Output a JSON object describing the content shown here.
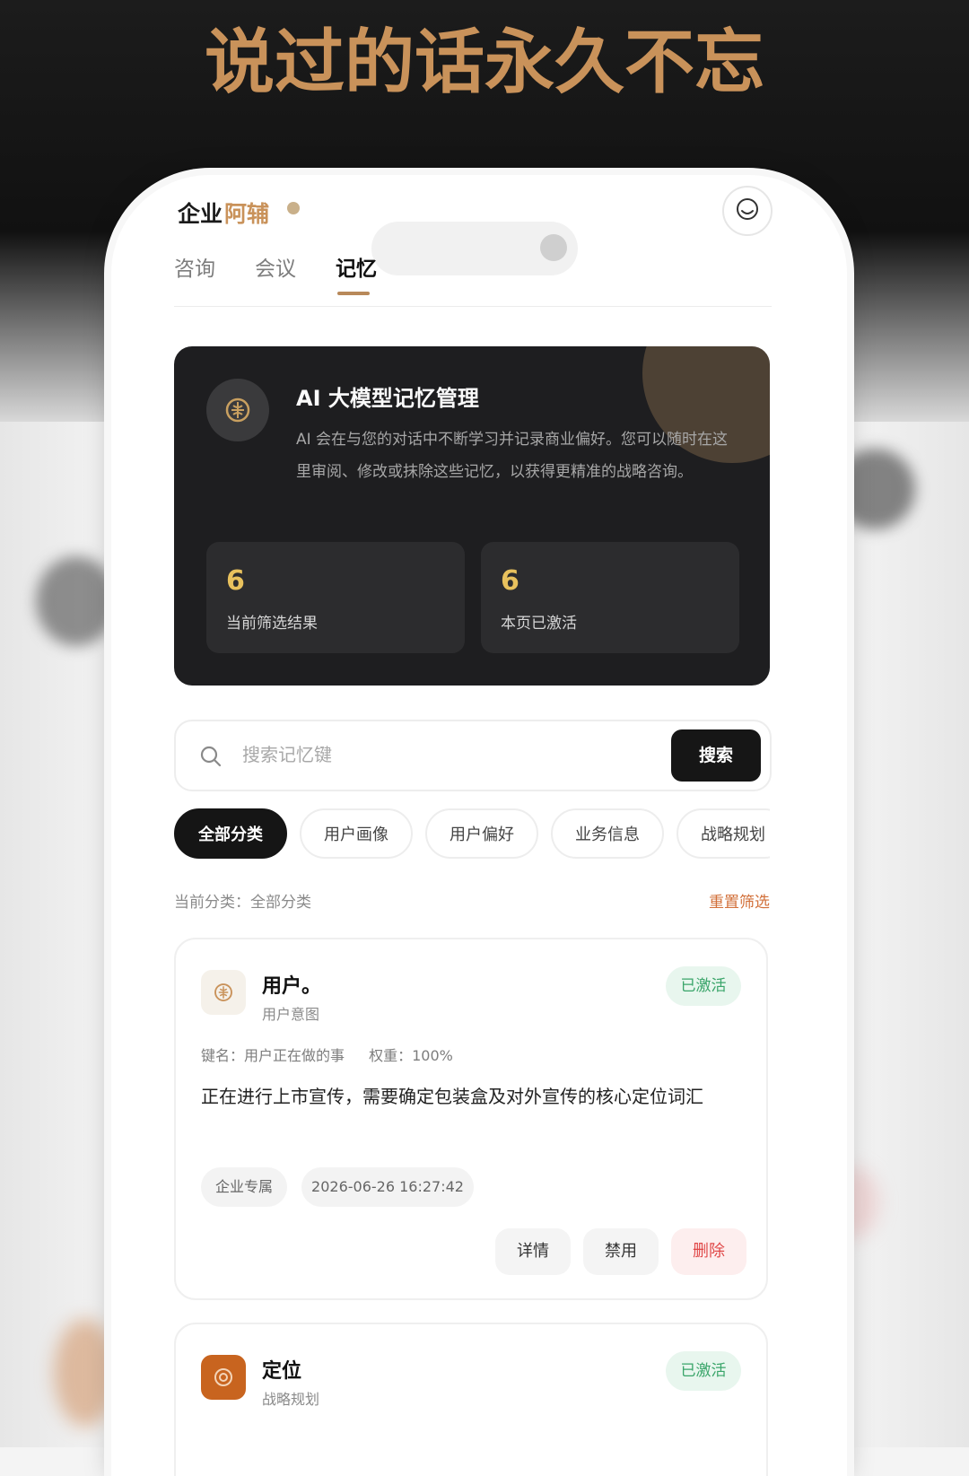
{
  "banner": {
    "slogan": "说过的话永久不忘"
  },
  "app": {
    "brand": "企业阿辅"
  },
  "tabs": [
    {
      "label": "咨询"
    },
    {
      "label": "会议"
    },
    {
      "label": "记忆",
      "active": true
    }
  ],
  "hero": {
    "title": "AI 大模型记忆管理",
    "description": "AI 会在与您的对话中不断学习并记录商业偏好。您可以随时在这里审阅、修改或抹除这些记忆，以获得更精准的战略咨询。",
    "stats": [
      {
        "value": "6",
        "label": "当前筛选结果"
      },
      {
        "value": "6",
        "label": "本页已激活"
      }
    ]
  },
  "search": {
    "placeholder": "搜索记忆键",
    "button_label": "搜索"
  },
  "categories": [
    {
      "label": "全部分类",
      "active": true
    },
    {
      "label": "用户画像"
    },
    {
      "label": "用户偏好"
    },
    {
      "label": "业务信息"
    },
    {
      "label": "战略规划"
    }
  ],
  "filter": {
    "current": "当前分类：全部分类",
    "reset_label": "重置筛选"
  },
  "memories": [
    {
      "title": "用户。",
      "category": "用户意图",
      "status": "已激活",
      "key": "键名：用户正在做的事",
      "weight": "权重：100%",
      "content": "正在进行上市宣传，需要确定包装盒及对外宣传的核心定位词汇",
      "scope": "企业专属",
      "time": "2026-06-26 16:27:42",
      "actions": {
        "detail": "详情",
        "disable": "禁用",
        "delete": "删除"
      }
    },
    {
      "title": "定位",
      "category": "战略规划",
      "status": "已激活"
    }
  ],
  "colors": {
    "accent": "#b8895a",
    "slogan": "#c9925a",
    "gold_number": "#e8c15d",
    "active_green": "#3aa56a",
    "danger": "#e04848",
    "reset_orange": "#d2703a"
  }
}
